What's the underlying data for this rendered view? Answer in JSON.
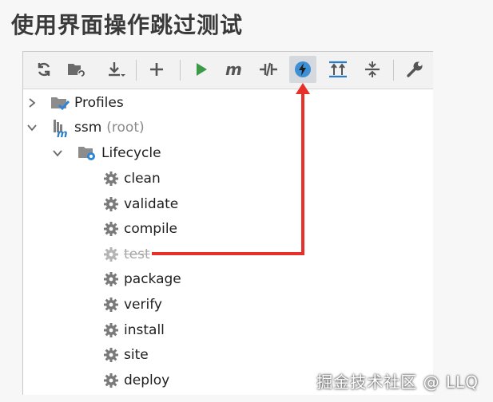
{
  "page": {
    "title": "使用界面操作跳过测试"
  },
  "toolbar": {
    "buttons": [
      {
        "icon": "reload-icon"
      },
      {
        "icon": "generate-sources-icon"
      },
      {
        "icon": "download-icon"
      },
      {
        "icon": "add-icon"
      },
      {
        "icon": "run-icon"
      },
      {
        "icon": "maven-goal-icon"
      },
      {
        "icon": "toggle-offline-icon"
      },
      {
        "icon": "skip-tests-icon",
        "active": true
      },
      {
        "icon": "show-dependencies-icon"
      },
      {
        "icon": "collapse-all-icon"
      },
      {
        "icon": "settings-wrench-icon"
      }
    ]
  },
  "tree": {
    "profiles": {
      "label": "Profiles"
    },
    "project": {
      "label": "ssm",
      "suffix": "(root)"
    },
    "lifecycle": {
      "label": "Lifecycle"
    },
    "phases": [
      {
        "label": "clean",
        "disabled": false
      },
      {
        "label": "validate",
        "disabled": false
      },
      {
        "label": "compile",
        "disabled": false
      },
      {
        "label": "test",
        "disabled": true
      },
      {
        "label": "package",
        "disabled": false
      },
      {
        "label": "verify",
        "disabled": false
      },
      {
        "label": "install",
        "disabled": false
      },
      {
        "label": "site",
        "disabled": false
      },
      {
        "label": "deploy",
        "disabled": false
      }
    ]
  },
  "annotation": {
    "color": "#e8302a"
  },
  "watermark": {
    "text": "掘金技术社区 @ LLQ"
  }
}
